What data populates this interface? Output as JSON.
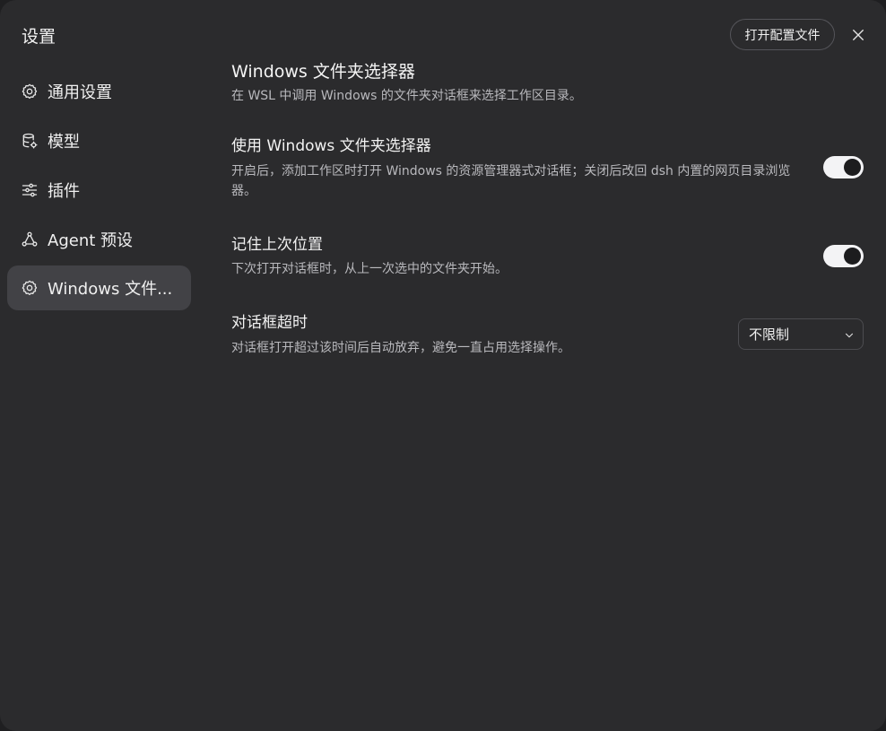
{
  "sidebar": {
    "title": "设置",
    "items": [
      {
        "label": "通用设置",
        "icon": "gear-icon",
        "active": false
      },
      {
        "label": "模型",
        "icon": "database-icon",
        "active": false
      },
      {
        "label": "插件",
        "icon": "sliders-icon",
        "active": false
      },
      {
        "label": "Agent 预设",
        "icon": "agent-network-icon",
        "active": false
      },
      {
        "label": "Windows 文件...",
        "icon": "gear-icon",
        "active": true
      }
    ]
  },
  "header": {
    "open_config_label": "打开配置文件",
    "close_icon": "close-icon"
  },
  "section": {
    "title": "Windows 文件夹选择器",
    "description": "在 WSL 中调用 Windows 的文件夹对话框来选择工作区目录。"
  },
  "settings": {
    "use_picker": {
      "title": "使用 Windows 文件夹选择器",
      "description": "开启后，添加工作区时打开 Windows 的资源管理器式对话框；关闭后改回 dsh 内置的网页目录浏览器。",
      "enabled": true
    },
    "remember_location": {
      "title": "记住上次位置",
      "description": "下次打开对话框时，从上一次选中的文件夹开始。",
      "enabled": true
    },
    "dialog_timeout": {
      "title": "对话框超时",
      "description": "对话框打开超过该时间后自动放弃，避免一直占用选择操作。",
      "selected": "不限制"
    }
  },
  "colors": {
    "background": "#2b2b2d",
    "active_item": "#424246",
    "toggle_on": "#f3f3f5"
  }
}
